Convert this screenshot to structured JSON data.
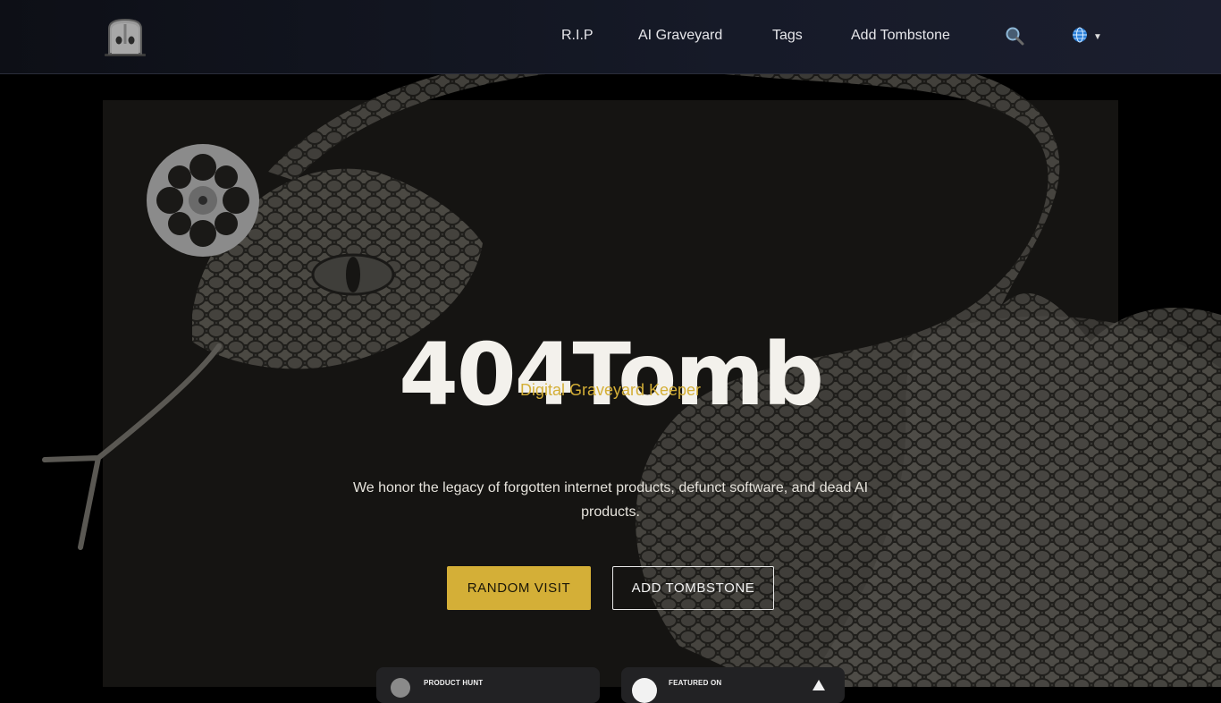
{
  "nav": {
    "items": [
      {
        "label": "R.I.P"
      },
      {
        "label": "AI Graveyard"
      },
      {
        "label": "Tags"
      },
      {
        "label": "Add Tombstone"
      }
    ],
    "search_icon": "search-icon",
    "language_icon": "globe-icon"
  },
  "hero": {
    "title": "404Tomb",
    "subtitle": "Digital Graveyard Keeper",
    "description": "We honor the legacy of forgotten internet products, defunct software, and dead AI products.",
    "buttons": {
      "random_visit": "RANDOM VISIT",
      "add_tombstone": "ADD TOMBSTONE"
    }
  },
  "badges": [
    {
      "label": "PRODUCT HUNT"
    },
    {
      "label": "FEATURED ON"
    }
  ],
  "colors": {
    "accent": "#d4af37",
    "background": "#000000",
    "hero_panel": "#151412"
  }
}
